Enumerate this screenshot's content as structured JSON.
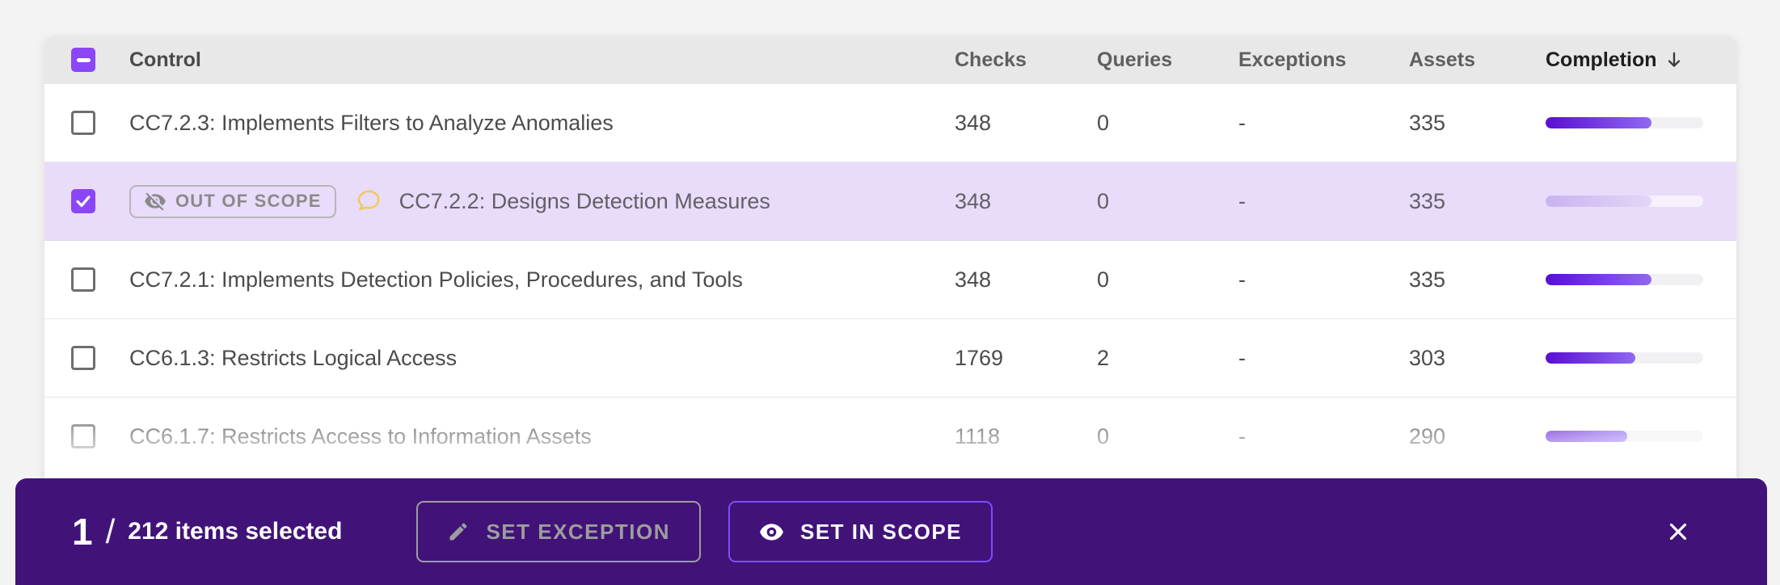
{
  "table": {
    "select_all_state": "indeterminate",
    "columns": {
      "control": "Control",
      "checks": "Checks",
      "queries": "Queries",
      "exceptions": "Exceptions",
      "assets": "Assets",
      "completion": "Completion"
    },
    "sort": {
      "column": "completion",
      "direction": "descending"
    },
    "rows": [
      {
        "selected": false,
        "control": "CC7.2.3: Implements Filters to Analyze Anomalies",
        "checks": "348",
        "queries": "0",
        "exceptions": "-",
        "assets": "335",
        "completion_pct": 67
      },
      {
        "selected": true,
        "scope_badge": "OUT OF SCOPE",
        "has_comment": true,
        "control": "CC7.2.2: Designs Detection Measures",
        "checks": "348",
        "queries": "0",
        "exceptions": "-",
        "assets": "335",
        "completion_pct": 67
      },
      {
        "selected": false,
        "control": "CC7.2.1: Implements Detection Policies, Procedures, and Tools",
        "checks": "348",
        "queries": "0",
        "exceptions": "-",
        "assets": "335",
        "completion_pct": 67
      },
      {
        "selected": false,
        "control": "CC6.1.3: Restricts Logical Access",
        "checks": "1769",
        "queries": "2",
        "exceptions": "-",
        "assets": "303",
        "completion_pct": 57
      },
      {
        "selected": false,
        "control": "CC6.1.7: Restricts Access to Information Assets",
        "checks": "1118",
        "queries": "0",
        "exceptions": "-",
        "assets": "290",
        "completion_pct": 52
      }
    ]
  },
  "action_bar": {
    "selected_count": "1",
    "separator": "/",
    "selected_label": "212 items selected",
    "set_exception_label": "SET EXCEPTION",
    "set_in_scope_label": "SET IN SCOPE"
  },
  "colors": {
    "accent_purple": "#8b46f7",
    "action_bar_purple": "#411379",
    "in_scope_border": "#7c4dff",
    "selected_row_bg": "#e8dcfa",
    "progress_start": "#5a0ed2",
    "progress_end": "#9068f2",
    "comment_icon_yellow": "#f0c95e",
    "header_bg": "#e9e8e9"
  }
}
